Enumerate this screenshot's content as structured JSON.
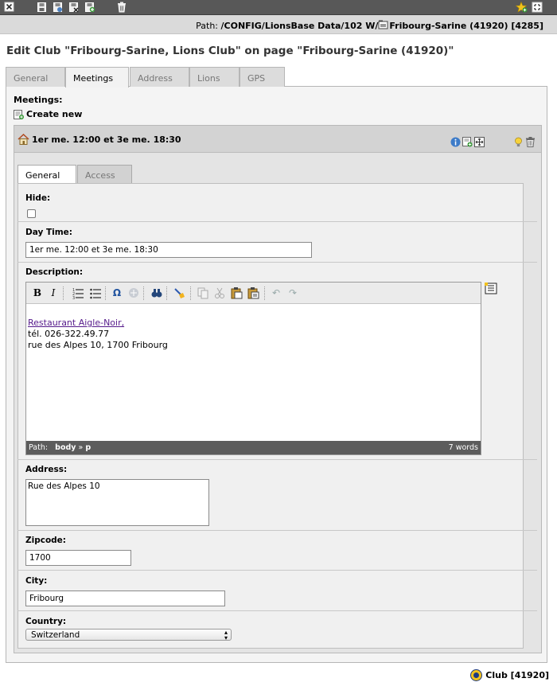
{
  "toolbar": {
    "left_icons": [
      "close-icon",
      "save-icon",
      "save-view-icon",
      "save-close-icon",
      "save-new-icon",
      "delete-icon"
    ],
    "right_icons": [
      "shortcut-star-icon",
      "open-new-window-icon"
    ]
  },
  "path": {
    "label": "Path:",
    "value": "/CONFIG/LionsBase Data/102 W/",
    "page": "Fribourg-Sarine (41920) [4285]"
  },
  "page_title": "Edit Club \"Fribourg-Sarine, Lions Club\" on page \"Fribourg-Sarine (41920)\"",
  "tabs": [
    {
      "label": "General",
      "active": false
    },
    {
      "label": "Meetings",
      "active": true
    },
    {
      "label": "Address",
      "active": false
    },
    {
      "label": "Lions",
      "active": false
    },
    {
      "label": "GPS",
      "active": false
    }
  ],
  "meetings": {
    "heading": "Meetings:",
    "create_new": "Create new",
    "item_title": "1er me. 12:00 et 3e me. 18:30",
    "inner_tabs": [
      {
        "label": "General",
        "active": true
      },
      {
        "label": "Access",
        "active": false
      }
    ]
  },
  "form": {
    "hide_label": "Hide:",
    "hide_checked": false,
    "daytime_label": "Day Time:",
    "daytime_value": "1er me. 12:00 et 3e me. 18:30",
    "description_label": "Description:",
    "description_lines": [
      "Restaurant Aigle-Noir,",
      "tél. 026-322.49.77",
      "rue des Alpes 10, 1700 Fribourg"
    ],
    "editor_path_label": "Path:",
    "editor_path_body": "body",
    "editor_path_sep": "»",
    "editor_path_p": "p",
    "editor_word_count": "7 words",
    "address_label": "Address:",
    "address_value": "Rue des Alpes 10",
    "zipcode_label": "Zipcode:",
    "zipcode_value": "1700",
    "city_label": "City:",
    "city_value": "Fribourg",
    "country_label": "Country:",
    "country_value": "Switzerland"
  },
  "footer": {
    "record": "Club [41920]"
  },
  "colors": {
    "toolbar_bg": "#585858",
    "link": "#551a8b",
    "spellcheck": "#dd0000"
  }
}
